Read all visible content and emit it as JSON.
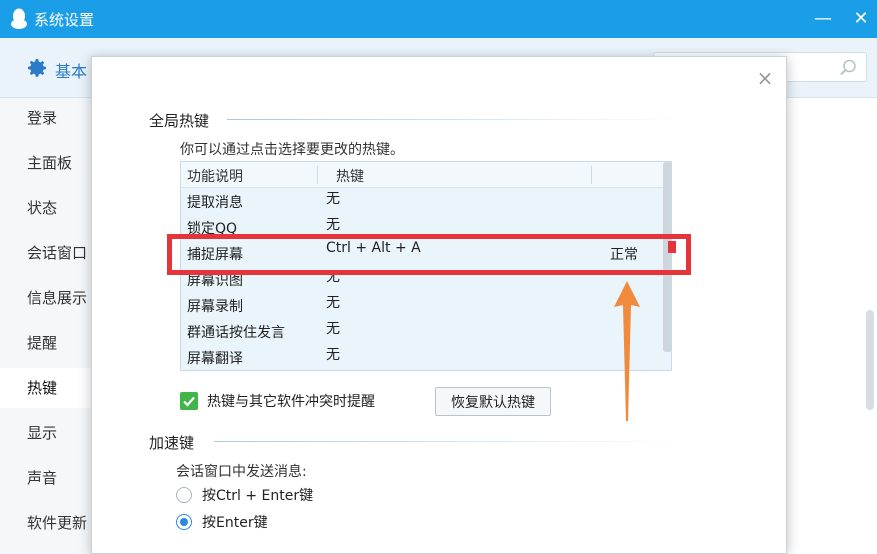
{
  "window": {
    "title": "系统设置",
    "min_label": "—",
    "close_label": "✕"
  },
  "background": {
    "header_label": "基本",
    "sidebar": [
      "登录",
      "主面板",
      "状态",
      "会话窗口",
      "信息展示",
      "提醒",
      "热键",
      "显示",
      "声音",
      "软件更新"
    ]
  },
  "dialog": {
    "close_label": "×",
    "global_hotkeys": {
      "title": "全局热键",
      "description": "你可以通过点击选择要更改的热键。",
      "columns": [
        "功能说明",
        "热键"
      ],
      "rows": [
        {
          "name": "提取消息",
          "key": "无",
          "status": ""
        },
        {
          "name": "锁定QQ",
          "key": "无",
          "status": ""
        },
        {
          "name": "捕捉屏幕",
          "key": "Ctrl + Alt + A",
          "status": "正常"
        },
        {
          "name": "屏幕识图",
          "key": "无",
          "status": ""
        },
        {
          "name": "屏幕录制",
          "key": "无",
          "status": ""
        },
        {
          "name": "群通话按住发言",
          "key": "无",
          "status": ""
        },
        {
          "name": "屏幕翻译",
          "key": "无",
          "status": ""
        }
      ],
      "conflict_checkbox_label": "热键与其它软件冲突时提醒",
      "conflict_checked": true,
      "restore_button": "恢复默认热键"
    },
    "accelerator": {
      "title": "加速键",
      "send_label": "会话窗口中发送消息:",
      "options": [
        {
          "label": "按Ctrl + Enter键",
          "checked": false
        },
        {
          "label": "按Enter键",
          "checked": true
        }
      ]
    }
  },
  "colors": {
    "titlebar": "#1a9ee8",
    "highlight": "#e6343b",
    "arrow": "#f08a3c",
    "check": "#41b54a"
  }
}
